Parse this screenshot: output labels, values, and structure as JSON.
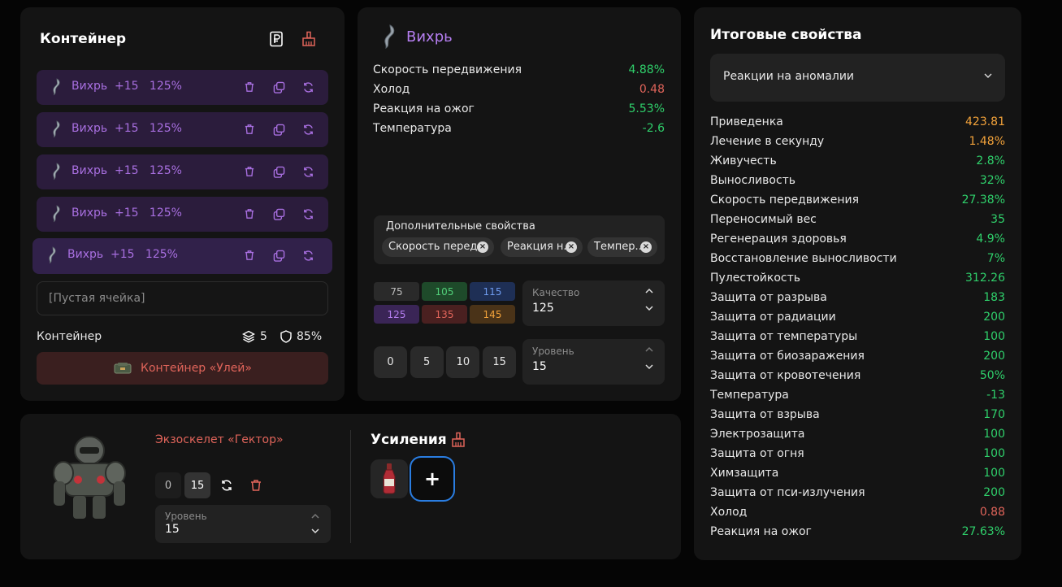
{
  "colors": {
    "green": "#2fd06b",
    "red": "#e0645a",
    "orange": "#f2a23a",
    "purple": "#a86fe0"
  },
  "container": {
    "title": "Контейнер",
    "header_icons": [
      "ruble-doc-icon",
      "broom-icon"
    ],
    "artifacts": [
      {
        "name": "Вихрь",
        "level": "+15",
        "quality": "125%"
      },
      {
        "name": "Вихрь",
        "level": "+15",
        "quality": "125%"
      },
      {
        "name": "Вихрь",
        "level": "+15",
        "quality": "125%"
      },
      {
        "name": "Вихрь",
        "level": "+15",
        "quality": "125%"
      },
      {
        "name": "Вихрь",
        "level": "+15",
        "quality": "125%"
      }
    ],
    "row_icons": [
      "trash-icon",
      "copy-icon",
      "refresh-icon"
    ],
    "empty_slot": "[Пустая ячейка]",
    "footer_label": "Контейнер",
    "slots": "5",
    "protection": "85%",
    "container_name": "Контейнер «Улей»"
  },
  "artifact": {
    "title": "Вихрь",
    "properties": [
      {
        "name": "Скорость передвижения",
        "value": "4.88%",
        "tone": "green"
      },
      {
        "name": "Холод",
        "value": "0.48",
        "tone": "red"
      },
      {
        "name": "Реакция на ожог",
        "value": "5.53%",
        "tone": "green"
      },
      {
        "name": "Температура",
        "value": "-2.6",
        "tone": "green"
      }
    ],
    "additional_title": "Дополнительные свойства",
    "additional_chips": [
      "Скорость перед...",
      "Реакция н...",
      "Темпер..."
    ],
    "quality_chips": [
      {
        "label": "75",
        "bg": "#2a2a2a",
        "fg": "#bdbdbd"
      },
      {
        "label": "105",
        "bg": "#1e4a2a",
        "fg": "#52d07a"
      },
      {
        "label": "115",
        "bg": "#1e2f55",
        "fg": "#6f9cf0"
      },
      {
        "label": "125",
        "bg": "#3a2556",
        "fg": "#b57ef0"
      },
      {
        "label": "135",
        "bg": "#4a2020",
        "fg": "#e0645a"
      },
      {
        "label": "145",
        "bg": "#4a3318",
        "fg": "#f2a23a"
      }
    ],
    "quality_label": "Качество",
    "quality_value": "125",
    "level_buttons": [
      "0",
      "5",
      "10",
      "15"
    ],
    "level_label": "Уровень",
    "level_value": "15"
  },
  "exoskeleton": {
    "name": "Экзоскелет «Гектор»",
    "chips": [
      "0",
      "15"
    ],
    "level_label": "Уровень",
    "level_value": "15",
    "boosts_title": "Усиления",
    "add_label": "+"
  },
  "summary": {
    "title": "Итоговые свойства",
    "filter": "Реакции на аномалии",
    "rows": [
      {
        "name": "Приведенка",
        "value": "423.81",
        "tone": "orange"
      },
      {
        "name": "Лечение в секунду",
        "value": "1.48%",
        "tone": "orange"
      },
      {
        "name": "Живучесть",
        "value": "2.8%",
        "tone": "green"
      },
      {
        "name": "Выносливость",
        "value": "32%",
        "tone": "green"
      },
      {
        "name": "Скорость передвижения",
        "value": "27.38%",
        "tone": "green"
      },
      {
        "name": "Переносимый вес",
        "value": "35",
        "tone": "green"
      },
      {
        "name": "Регенерация здоровья",
        "value": "4.9%",
        "tone": "green"
      },
      {
        "name": "Восстановление выносливости",
        "value": "7%",
        "tone": "green"
      },
      {
        "name": "Пулестойкость",
        "value": "312.26",
        "tone": "green"
      },
      {
        "name": "Защита от разрыва",
        "value": "183",
        "tone": "green"
      },
      {
        "name": "Защита от радиации",
        "value": "200",
        "tone": "green"
      },
      {
        "name": "Защита от температуры",
        "value": "100",
        "tone": "green"
      },
      {
        "name": "Защита от биозаражения",
        "value": "200",
        "tone": "green"
      },
      {
        "name": "Защита от кровотечения",
        "value": "50%",
        "tone": "green"
      },
      {
        "name": "Температура",
        "value": "-13",
        "tone": "green"
      },
      {
        "name": "Защита от взрыва",
        "value": "170",
        "tone": "green"
      },
      {
        "name": "Электрозащита",
        "value": "100",
        "tone": "green"
      },
      {
        "name": "Защита от огня",
        "value": "100",
        "tone": "green"
      },
      {
        "name": "Химзащита",
        "value": "100",
        "tone": "green"
      },
      {
        "name": "Защита от пси-излучения",
        "value": "200",
        "tone": "green"
      },
      {
        "name": "Холод",
        "value": "0.88",
        "tone": "red"
      },
      {
        "name": "Реакция на ожог",
        "value": "27.63%",
        "tone": "green"
      }
    ]
  }
}
